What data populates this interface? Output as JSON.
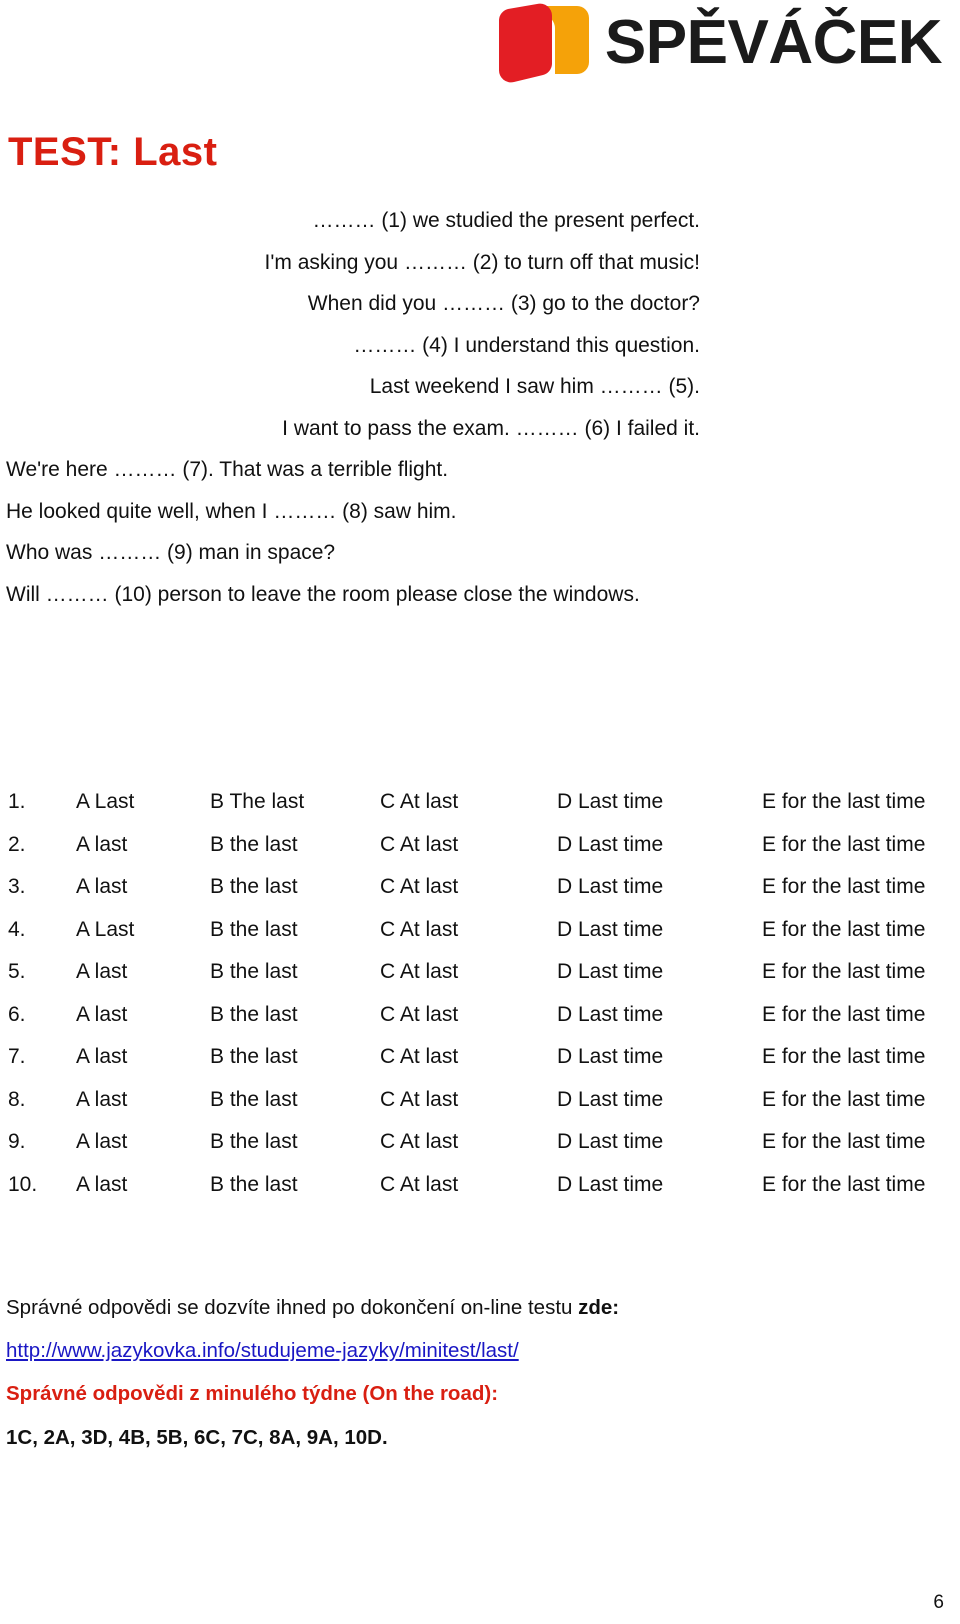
{
  "header": {
    "logo_icon": "book-logo-icon",
    "brand": "SPĚVÁČEK",
    "brand_colors": {
      "front": "#e31e24",
      "back": "#f5a209",
      "text": "#1b1b1b"
    }
  },
  "title": "TEST: Last",
  "title_color": "#d91f11",
  "sentences": [
    {
      "text": "……… (1) we studied the present perfect.",
      "align": "right"
    },
    {
      "text": "I'm asking you ……… (2) to turn off that music!",
      "align": "right"
    },
    {
      "text": "When did you ……… (3) go to the doctor?",
      "align": "right"
    },
    {
      "text": "……… (4) I understand this question.",
      "align": "right"
    },
    {
      "text": "Last weekend I saw him ……… (5).",
      "align": "right"
    },
    {
      "text": "I want to pass the exam. ……… (6) I failed it.",
      "align": "right"
    },
    {
      "text": "We're here ……… (7). That was a terrible flight.",
      "align": "left"
    },
    {
      "text": "He looked quite well, when I ……… (8) saw him.",
      "align": "left"
    },
    {
      "text": "Who was ……… (9) man in space?",
      "align": "left"
    },
    {
      "text": "Will ……… (10) person to leave the room please close the windows.",
      "align": "left"
    }
  ],
  "options": {
    "rows": [
      {
        "num": "1.",
        "a": "A Last",
        "b": "B The last",
        "c": "C At last",
        "d": "D Last time",
        "e": "E for the last time"
      },
      {
        "num": "2.",
        "a": "A last",
        "b": "B the last",
        "c": "C At last",
        "d": "D Last time",
        "e": "E for the last time"
      },
      {
        "num": "3.",
        "a": "A last",
        "b": "B the last",
        "c": "C At last",
        "d": "D Last time",
        "e": "E for the last time"
      },
      {
        "num": "4.",
        "a": "A Last",
        "b": "B the last",
        "c": "C At last",
        "d": "D Last time",
        "e": "E for the last time"
      },
      {
        "num": "5.",
        "a": "A last",
        "b": "B the last",
        "c": "C At last",
        "d": "D Last time",
        "e": "E for the last time"
      },
      {
        "num": "6.",
        "a": "A last",
        "b": "B the last",
        "c": "C At last",
        "d": "D Last time",
        "e": "E for the last time"
      },
      {
        "num": "7.",
        "a": "A last",
        "b": "B the last",
        "c": "C At last",
        "d": "D Last time",
        "e": "E for the last time"
      },
      {
        "num": "8.",
        "a": "A last",
        "b": "B the last",
        "c": "C At last",
        "d": "D Last time",
        "e": "E for the last time"
      },
      {
        "num": "9.",
        "a": "A last",
        "b": "B the last",
        "c": "C At last",
        "d": "D Last time",
        "e": "E for the last time"
      },
      {
        "num": "10.",
        "a": "A last",
        "b": "B the last",
        "c": "C At last",
        "d": "D Last time",
        "e": "E for the last time"
      }
    ]
  },
  "footer": {
    "info_text": "Správné odpovědi se dozvíte ihned po dokončení on-line testu ",
    "info_bold": "zde:",
    "url": "http://www.jazykovka.info/studujeme-jazyky/minitest/last/",
    "url_color": "#1a17c4",
    "previous_heading": "Správné odpovědi z minulého týdne (On the road):",
    "previous_heading_color": "#d91f11",
    "previous_answers": "1C, 2A, 3D, 4B, 5B, 6C, 7C, 8A, 9A, 10D."
  },
  "page_number": "6"
}
